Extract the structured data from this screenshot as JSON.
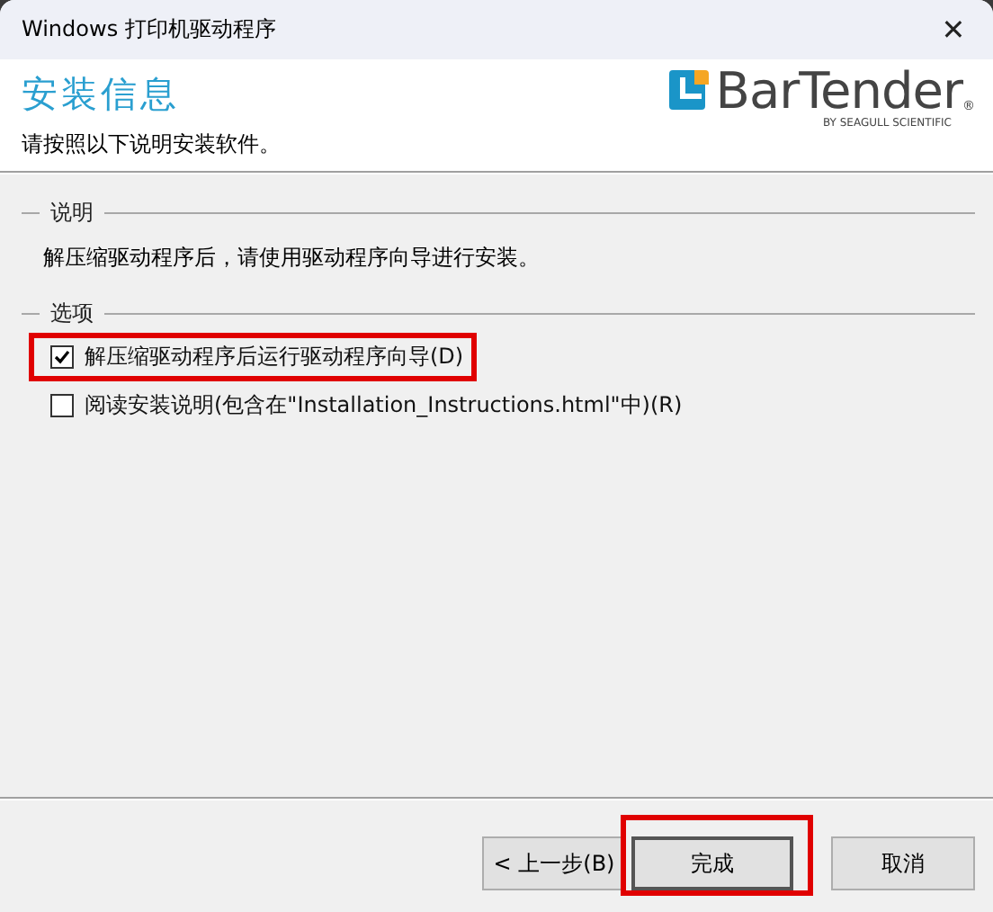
{
  "window": {
    "title": "Windows 打印机驱动程序",
    "close": "✕"
  },
  "header": {
    "title": "安装信息",
    "subtitle": "请按照以下说明安装软件。",
    "logo": {
      "name": "BarTender",
      "registered": "®",
      "tagline": "BY SEAGULL SCIENTIFIC"
    }
  },
  "instructions": {
    "heading": "说明",
    "text": "解压缩驱动程序后，请使用驱动程序向导进行安装。"
  },
  "options": {
    "heading": "选项",
    "items": [
      {
        "label": "解压缩驱动程序后运行驱动程序向导(D)",
        "checked": true,
        "highlighted": true
      },
      {
        "label": "阅读安装说明(包含在\"Installation_Instructions.html\"中)(R)",
        "checked": false,
        "highlighted": false
      }
    ]
  },
  "buttons": [
    {
      "label": "< 上一步(B)",
      "highlighted": false,
      "focused": false
    },
    {
      "label": "完成",
      "highlighted": true,
      "focused": true
    },
    {
      "label": "取消",
      "highlighted": false,
      "focused": false
    }
  ]
}
